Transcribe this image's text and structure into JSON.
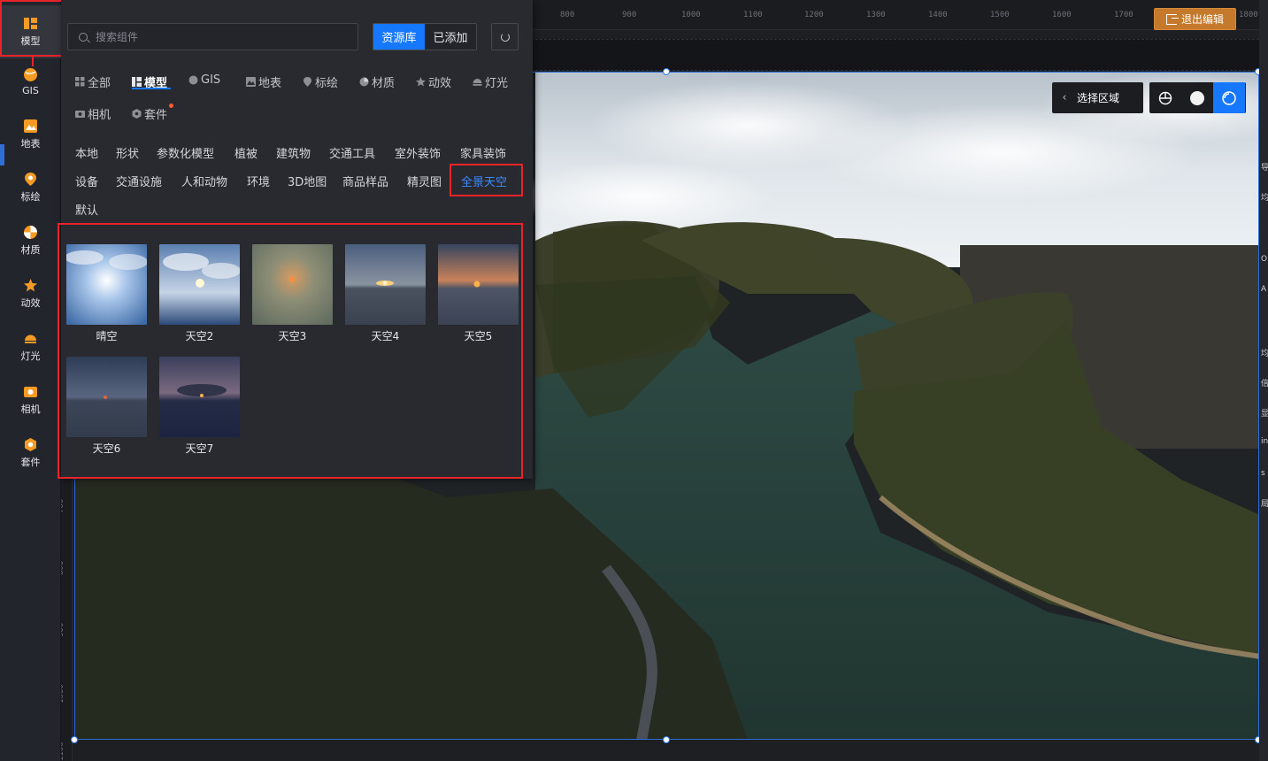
{
  "rail": {
    "items": [
      {
        "label": "模型",
        "icon": "model-icon"
      },
      {
        "label": "GIS",
        "icon": "gis-globe-icon"
      },
      {
        "label": "地表",
        "icon": "terrain-icon"
      },
      {
        "label": "标绘",
        "icon": "map-pin-icon"
      },
      {
        "label": "材质",
        "icon": "material-ball-icon"
      },
      {
        "label": "动效",
        "icon": "effect-star-icon"
      },
      {
        "label": "灯光",
        "icon": "light-icon"
      },
      {
        "label": "相机",
        "icon": "camera-icon"
      },
      {
        "label": "套件",
        "icon": "kit-icon"
      }
    ]
  },
  "toolbar": {
    "exit_label": "退出编辑",
    "region_label": "选择区域"
  },
  "ruler": {
    "top": [
      "800",
      "900",
      "1000",
      "1100",
      "1200",
      "1300",
      "1400",
      "1500",
      "1600",
      "1700",
      "1800"
    ],
    "left": [
      "700",
      "800",
      "900",
      "1000",
      "1100"
    ]
  },
  "right_slice": [
    "导",
    "均",
    "O",
    "A",
    "均",
    "倍",
    "显",
    "in",
    "s",
    "局"
  ],
  "panel": {
    "search_placeholder": "搜索组件",
    "source_tabs": [
      "资源库",
      "已添加"
    ],
    "categories": [
      {
        "label": "全部",
        "icon": "grid-icon"
      },
      {
        "label": "模型",
        "icon": "model-icon"
      },
      {
        "label": "GIS",
        "icon": "globe-icon"
      },
      {
        "label": "地表",
        "icon": "terrain-icon"
      },
      {
        "label": "标绘",
        "icon": "pin-icon"
      },
      {
        "label": "材质",
        "icon": "material-icon"
      },
      {
        "label": "动效",
        "icon": "effect-icon"
      },
      {
        "label": "灯光",
        "icon": "light-icon"
      },
      {
        "label": "相机",
        "icon": "camera-icon"
      },
      {
        "label": "套件",
        "icon": "kit-icon"
      }
    ],
    "subcategories": [
      "本地",
      "形状",
      "参数化模型",
      "植被",
      "建筑物",
      "交通工具",
      "室外装饰",
      "家具装饰",
      "设备",
      "交通设施",
      "人和动物",
      "环境",
      "3D地图",
      "商品样品",
      "精灵图",
      "全景天空",
      "默认"
    ],
    "assets": [
      "晴空",
      "天空2",
      "天空3",
      "天空4",
      "天空5",
      "天空6",
      "天空7"
    ]
  },
  "colors": {
    "accent": "#1677ff",
    "highlight": "#e8242b",
    "exit": "#c57a2b"
  }
}
